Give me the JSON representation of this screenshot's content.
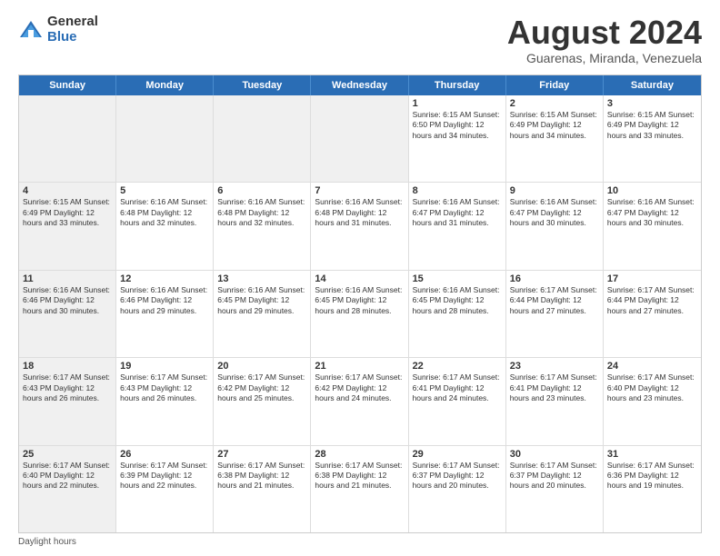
{
  "logo": {
    "general": "General",
    "blue": "Blue"
  },
  "title": "August 2024",
  "subtitle": "Guarenas, Miranda, Venezuela",
  "header_days": [
    "Sunday",
    "Monday",
    "Tuesday",
    "Wednesday",
    "Thursday",
    "Friday",
    "Saturday"
  ],
  "weeks": [
    [
      {
        "day": "",
        "info": "",
        "shaded": true
      },
      {
        "day": "",
        "info": "",
        "shaded": true
      },
      {
        "day": "",
        "info": "",
        "shaded": true
      },
      {
        "day": "",
        "info": "",
        "shaded": true
      },
      {
        "day": "1",
        "info": "Sunrise: 6:15 AM\nSunset: 6:50 PM\nDaylight: 12 hours\nand 34 minutes.",
        "shaded": false
      },
      {
        "day": "2",
        "info": "Sunrise: 6:15 AM\nSunset: 6:49 PM\nDaylight: 12 hours\nand 34 minutes.",
        "shaded": false
      },
      {
        "day": "3",
        "info": "Sunrise: 6:15 AM\nSunset: 6:49 PM\nDaylight: 12 hours\nand 33 minutes.",
        "shaded": false
      }
    ],
    [
      {
        "day": "4",
        "info": "Sunrise: 6:15 AM\nSunset: 6:49 PM\nDaylight: 12 hours\nand 33 minutes.",
        "shaded": true
      },
      {
        "day": "5",
        "info": "Sunrise: 6:16 AM\nSunset: 6:48 PM\nDaylight: 12 hours\nand 32 minutes.",
        "shaded": false
      },
      {
        "day": "6",
        "info": "Sunrise: 6:16 AM\nSunset: 6:48 PM\nDaylight: 12 hours\nand 32 minutes.",
        "shaded": false
      },
      {
        "day": "7",
        "info": "Sunrise: 6:16 AM\nSunset: 6:48 PM\nDaylight: 12 hours\nand 31 minutes.",
        "shaded": false
      },
      {
        "day": "8",
        "info": "Sunrise: 6:16 AM\nSunset: 6:47 PM\nDaylight: 12 hours\nand 31 minutes.",
        "shaded": false
      },
      {
        "day": "9",
        "info": "Sunrise: 6:16 AM\nSunset: 6:47 PM\nDaylight: 12 hours\nand 30 minutes.",
        "shaded": false
      },
      {
        "day": "10",
        "info": "Sunrise: 6:16 AM\nSunset: 6:47 PM\nDaylight: 12 hours\nand 30 minutes.",
        "shaded": false
      }
    ],
    [
      {
        "day": "11",
        "info": "Sunrise: 6:16 AM\nSunset: 6:46 PM\nDaylight: 12 hours\nand 30 minutes.",
        "shaded": true
      },
      {
        "day": "12",
        "info": "Sunrise: 6:16 AM\nSunset: 6:46 PM\nDaylight: 12 hours\nand 29 minutes.",
        "shaded": false
      },
      {
        "day": "13",
        "info": "Sunrise: 6:16 AM\nSunset: 6:45 PM\nDaylight: 12 hours\nand 29 minutes.",
        "shaded": false
      },
      {
        "day": "14",
        "info": "Sunrise: 6:16 AM\nSunset: 6:45 PM\nDaylight: 12 hours\nand 28 minutes.",
        "shaded": false
      },
      {
        "day": "15",
        "info": "Sunrise: 6:16 AM\nSunset: 6:45 PM\nDaylight: 12 hours\nand 28 minutes.",
        "shaded": false
      },
      {
        "day": "16",
        "info": "Sunrise: 6:17 AM\nSunset: 6:44 PM\nDaylight: 12 hours\nand 27 minutes.",
        "shaded": false
      },
      {
        "day": "17",
        "info": "Sunrise: 6:17 AM\nSunset: 6:44 PM\nDaylight: 12 hours\nand 27 minutes.",
        "shaded": false
      }
    ],
    [
      {
        "day": "18",
        "info": "Sunrise: 6:17 AM\nSunset: 6:43 PM\nDaylight: 12 hours\nand 26 minutes.",
        "shaded": true
      },
      {
        "day": "19",
        "info": "Sunrise: 6:17 AM\nSunset: 6:43 PM\nDaylight: 12 hours\nand 26 minutes.",
        "shaded": false
      },
      {
        "day": "20",
        "info": "Sunrise: 6:17 AM\nSunset: 6:42 PM\nDaylight: 12 hours\nand 25 minutes.",
        "shaded": false
      },
      {
        "day": "21",
        "info": "Sunrise: 6:17 AM\nSunset: 6:42 PM\nDaylight: 12 hours\nand 24 minutes.",
        "shaded": false
      },
      {
        "day": "22",
        "info": "Sunrise: 6:17 AM\nSunset: 6:41 PM\nDaylight: 12 hours\nand 24 minutes.",
        "shaded": false
      },
      {
        "day": "23",
        "info": "Sunrise: 6:17 AM\nSunset: 6:41 PM\nDaylight: 12 hours\nand 23 minutes.",
        "shaded": false
      },
      {
        "day": "24",
        "info": "Sunrise: 6:17 AM\nSunset: 6:40 PM\nDaylight: 12 hours\nand 23 minutes.",
        "shaded": false
      }
    ],
    [
      {
        "day": "25",
        "info": "Sunrise: 6:17 AM\nSunset: 6:40 PM\nDaylight: 12 hours\nand 22 minutes.",
        "shaded": true
      },
      {
        "day": "26",
        "info": "Sunrise: 6:17 AM\nSunset: 6:39 PM\nDaylight: 12 hours\nand 22 minutes.",
        "shaded": false
      },
      {
        "day": "27",
        "info": "Sunrise: 6:17 AM\nSunset: 6:38 PM\nDaylight: 12 hours\nand 21 minutes.",
        "shaded": false
      },
      {
        "day": "28",
        "info": "Sunrise: 6:17 AM\nSunset: 6:38 PM\nDaylight: 12 hours\nand 21 minutes.",
        "shaded": false
      },
      {
        "day": "29",
        "info": "Sunrise: 6:17 AM\nSunset: 6:37 PM\nDaylight: 12 hours\nand 20 minutes.",
        "shaded": false
      },
      {
        "day": "30",
        "info": "Sunrise: 6:17 AM\nSunset: 6:37 PM\nDaylight: 12 hours\nand 20 minutes.",
        "shaded": false
      },
      {
        "day": "31",
        "info": "Sunrise: 6:17 AM\nSunset: 6:36 PM\nDaylight: 12 hours\nand 19 minutes.",
        "shaded": false
      }
    ]
  ],
  "footer": "Daylight hours"
}
